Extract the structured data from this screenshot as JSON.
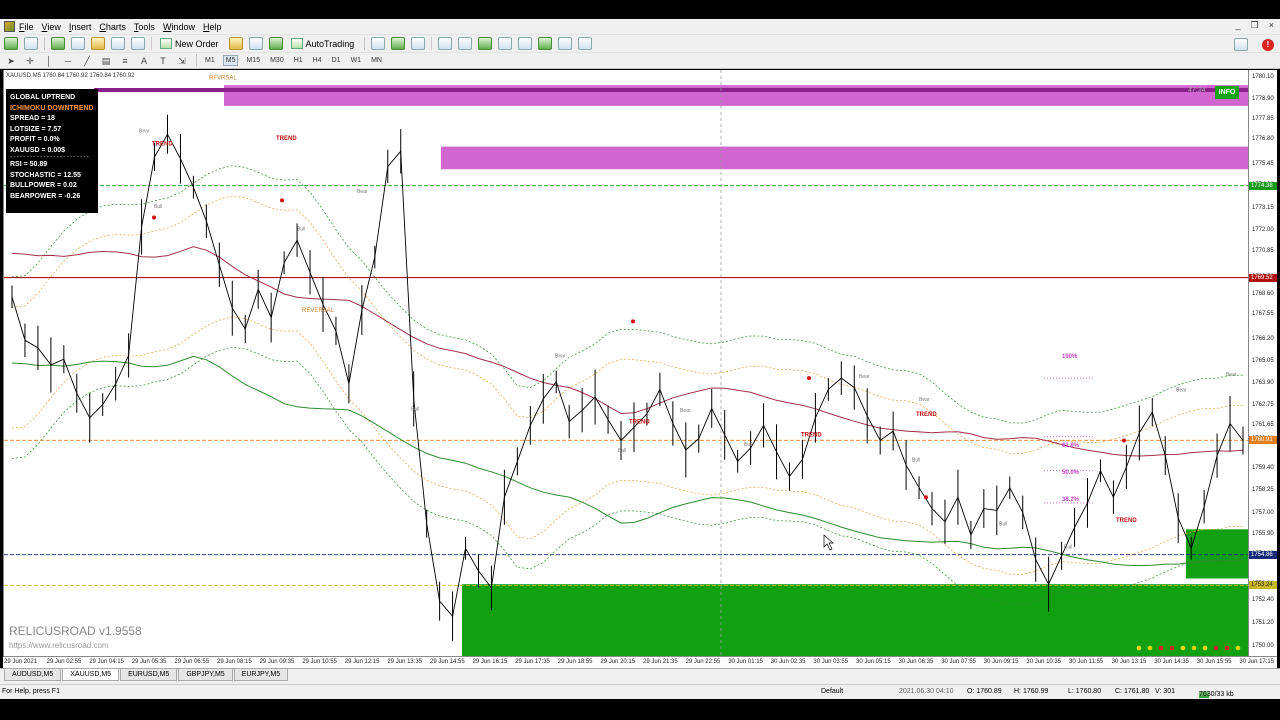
{
  "menu": [
    "File",
    "View",
    "Insert",
    "Charts",
    "Tools",
    "Window",
    "Help"
  ],
  "window_controls": [
    "_",
    "❐",
    "×"
  ],
  "toolbar": {
    "new_order": "New Order",
    "auto_trading": "AutoTrading"
  },
  "timeframes": [
    "M1",
    "M5",
    "M15",
    "M30",
    "H1",
    "H4",
    "D1",
    "W1",
    "MN"
  ],
  "active_timeframe": "M5",
  "symbol_line": "XAUUSD,M5  1760.84 1760.92 1760.84 1760.92",
  "info_panel": {
    "global_trend": "GLOBAL UPTREND",
    "ichimoku": "ICHIMOKU DOWNTREND",
    "spread": "SPREAD = 18",
    "lotsize": "LOTSIZE = 7.57",
    "profit": "PROFIT = 0.0%",
    "xauusd": "XAUUSD = 0.00$",
    "dash": "------------------------",
    "rsi": "RSI = 50.89",
    "stochastic": "STOCHASTIC = 12.55",
    "bullpower": "BULLPOWER = 0.02",
    "bearpower": "BEARPOWER = -0.26"
  },
  "info_button": "INFO",
  "timer": "47:34",
  "watermark": "RELICUSROAD v1.9558",
  "watermark_url": "https://www.relicusroad.com",
  "fibo_labels": {
    "f100": "100%",
    "f618": "61.8%",
    "f500": "50.0%",
    "f382": "38.2%"
  },
  "annotations": {
    "trend": "TREND",
    "reversal": "REVERSAL",
    "bear": "Bear",
    "bull": "Bull",
    "rfvrsal": "RFVRSAL"
  },
  "price_tags": {
    "green": "1774.38",
    "red": "1769.52",
    "orange": "1760.91",
    "navy": "1754.86",
    "yellow": "1753.24"
  },
  "colors": {
    "resistance_zone": "#cc55cc",
    "support_zone": "#11a011",
    "top_band": "#8b1f8b",
    "ma_red": "#a0304a",
    "ma_green": "#2f8a2f"
  },
  "chart_data": {
    "type": "line",
    "symbol": "XAUUSD",
    "timeframe": "M5",
    "y_ticks": [
      "1780.10",
      "1778.90",
      "1777.85",
      "1776.80",
      "1775.45",
      "1774.38",
      "1773.15",
      "1772.00",
      "1770.85",
      "1769.52",
      "1768.60",
      "1767.55",
      "1766.20",
      "1765.05",
      "1763.90",
      "1762.75",
      "1761.65",
      "1760.91",
      "1759.40",
      "1758.25",
      "1757.00",
      "1755.90",
      "1754.86",
      "1753.24",
      "1752.40",
      "1751.20",
      "1750.00"
    ],
    "ylim": [
      1749.5,
      1780.5
    ],
    "x_ticks": [
      "29 Jun 2021",
      "29 Jun 02:55",
      "29 Jun 04:15",
      "29 Jun 05:35",
      "29 Jun 06:55",
      "29 Jun 08:15",
      "29 Jun 09:35",
      "29 Jun 10:55",
      "29 Jun 12:15",
      "29 Jun 13:35",
      "29 Jun 14:55",
      "29 Jun 16:15",
      "29 Jun 17:35",
      "29 Jun 18:55",
      "29 Jun 20:15",
      "29 Jun 21:35",
      "29 Jun 22:55",
      "30 Jun 01:15",
      "30 Jun 02:35",
      "30 Jun 03:55",
      "30 Jun 05:15",
      "30 Jun 06:35",
      "30 Jun 07:55",
      "30 Jun 09:15",
      "30 Jun 10:35",
      "30 Jun 11:55",
      "30 Jun 13:15",
      "30 Jun 14:35",
      "30 Jun 15:55",
      "30 Jun 17:15"
    ],
    "series": [
      {
        "values": [
          1768.5,
          1766.2,
          1765.8,
          1764.9,
          1765.2,
          1763.4,
          1762.1,
          1762.8,
          1763.9,
          1765.4,
          1772.2,
          1775.9,
          1777.1,
          1775.8,
          1774.3,
          1772.5,
          1770.2,
          1767.9,
          1766.8,
          1768.9,
          1767.4,
          1770.3,
          1771.5,
          1769.8,
          1768.1,
          1766.7,
          1763.9,
          1767.8,
          1770.6,
          1775.4,
          1776.2,
          1763.1,
          1756.5,
          1752.4,
          1751.6,
          1755.2,
          1754.0,
          1753.1,
          1757.9,
          1759.8,
          1761.7,
          1763.1,
          1764.0,
          1761.9,
          1762.5,
          1763.2,
          1762.0,
          1760.9,
          1761.6,
          1762.3,
          1763.6,
          1761.8,
          1760.4,
          1761.0,
          1762.6,
          1761.2,
          1759.8,
          1760.5,
          1761.7,
          1760.3,
          1759.0,
          1759.9,
          1762.1,
          1763.6,
          1764.2,
          1763.7,
          1762.2,
          1760.9,
          1761.4,
          1759.6,
          1758.4,
          1757.3,
          1756.6,
          1757.9,
          1755.9,
          1757.3,
          1757.2,
          1758.4,
          1757.1,
          1754.6,
          1753.3,
          1754.8,
          1756.3,
          1757.6,
          1759.3,
          1757.9,
          1759.5,
          1761.3,
          1762.4,
          1760.1,
          1756.8,
          1755.2,
          1757.4,
          1760.1,
          1761.8,
          1760.9
        ]
      }
    ],
    "horizontal_lines": [
      1774.38,
      1769.52,
      1760.91,
      1754.86,
      1753.24
    ],
    "zones": [
      {
        "from": 1778.6,
        "to": 1779.7,
        "color": "#cc55cc"
      },
      {
        "from": 1775.25,
        "to": 1776.45,
        "color": "#cc55cc"
      },
      {
        "from": 1749.5,
        "to": 1753.3,
        "color": "#11a011"
      }
    ],
    "fibonacci": [
      {
        "level": "100%",
        "price": 1764.2
      },
      {
        "level": "61.8%",
        "price": 1761.1
      },
      {
        "level": "50.0%",
        "price": 1759.3
      },
      {
        "level": "38.2%",
        "price": 1757.6
      }
    ]
  },
  "symbol_tabs": [
    "AUDUSD,M5",
    "XAUUSD,M5",
    "EURUSD,M5",
    "GBPJPY,M5",
    "EURJPY,M5"
  ],
  "active_tab": "XAUUSD,M5",
  "status": {
    "help": "For Help, press F1",
    "profile": "Default",
    "datetime": "2021.06.30 04:10",
    "open": "O: 1760.89",
    "high": "H: 1760.99",
    "low": "L: 1760.80",
    "close": "C: 1761.80",
    "volume": "V: 301",
    "traffic": "7630/33 kb"
  }
}
